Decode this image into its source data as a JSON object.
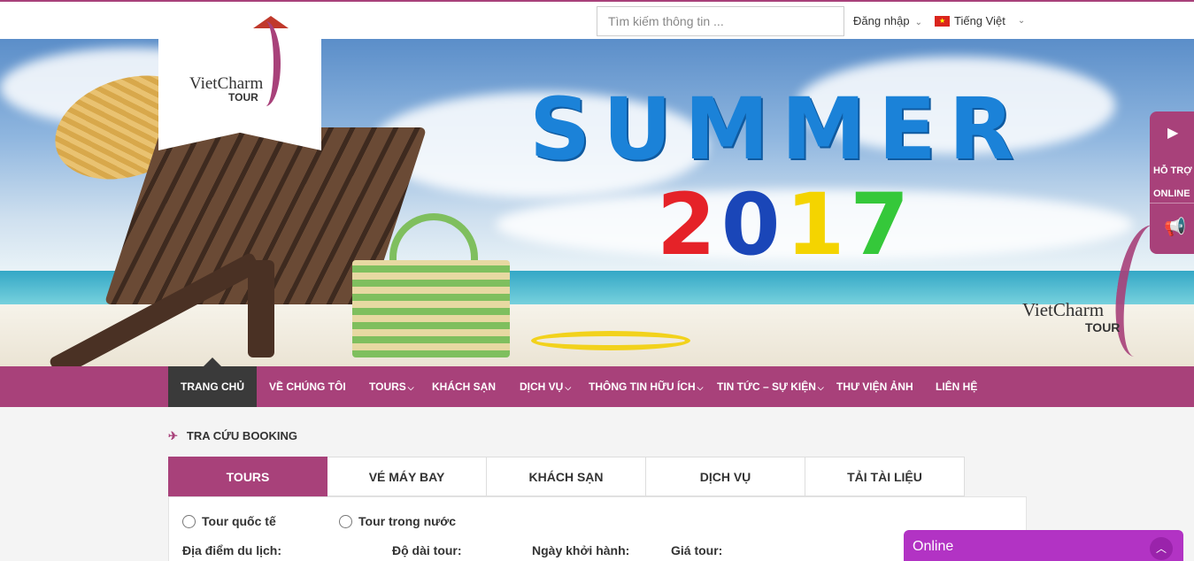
{
  "header": {
    "search_placeholder": "Tìm kiếm thông tin ...",
    "login_label": "Đăng nhập",
    "language_label": "Tiếng Việt"
  },
  "logo": {
    "brand": "VietCharm",
    "sub": "TOUR"
  },
  "banner": {
    "headline": "SUMMER",
    "year_digits": [
      "2",
      "0",
      "1",
      "7"
    ],
    "watermark_brand": "VietCharm",
    "watermark_sub": "TOUR"
  },
  "support": {
    "line1": "HỖ TRỢ",
    "line2": "ONLINE"
  },
  "nav": {
    "items": [
      {
        "label": "TRANG CHỦ"
      },
      {
        "label": "VỀ CHÚNG TÔI"
      },
      {
        "label": "TOURS"
      },
      {
        "label": "KHÁCH SẠN"
      },
      {
        "label": "DỊCH VỤ"
      },
      {
        "label": "THÔNG TIN HỮU ÍCH"
      },
      {
        "label": "TIN TỨC – SỰ KIỆN"
      },
      {
        "label": "THƯ VIỆN ẢNH"
      },
      {
        "label": "LIÊN HỆ"
      }
    ]
  },
  "booking": {
    "title": "TRA CỨU BOOKING",
    "tabs": [
      {
        "label": "TOURS"
      },
      {
        "label": "VÉ MÁY BAY"
      },
      {
        "label": "KHÁCH SẠN"
      },
      {
        "label": "DỊCH VỤ"
      },
      {
        "label": "TẢI TÀI LIỆU"
      }
    ],
    "radio_international": "Tour quốc tế",
    "radio_domestic": "Tour trong nước",
    "label_destination": "Địa điểm du lịch:",
    "label_duration": "Độ dài tour:",
    "label_departure": "Ngày khởi hành:",
    "label_price": "Giá tour:"
  },
  "chat": {
    "label": "Online"
  },
  "colors": {
    "brand": "#a8417a",
    "chat": "#b233c4",
    "active_nav": "#3a3a3a"
  }
}
